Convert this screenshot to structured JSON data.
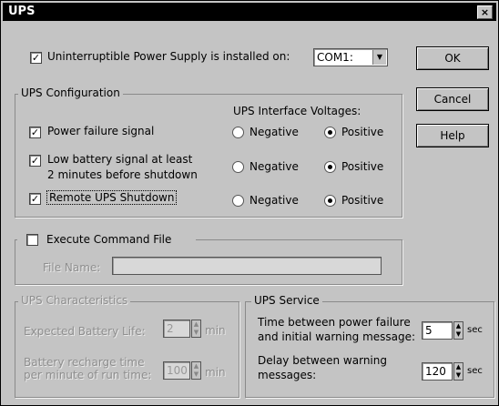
{
  "window": {
    "title": "UPS",
    "close_glyph": "×"
  },
  "ups_installed": {
    "checked": true,
    "label": "Uninterruptible Power Supply is installed on:",
    "port": "COM1:"
  },
  "buttons": {
    "ok": "OK",
    "cancel": "Cancel",
    "help": "Help"
  },
  "config": {
    "legend": "UPS Configuration",
    "voltages_heading": "UPS Interface Voltages:",
    "negative": "Negative",
    "positive": "Positive",
    "rows": [
      {
        "label": "Power failure signal",
        "label2": "",
        "checked": true,
        "polarity": "Positive"
      },
      {
        "label": "Low battery signal at least",
        "label2": "2 minutes before shutdown",
        "checked": true,
        "polarity": "Positive"
      },
      {
        "label": "Remote UPS Shutdown",
        "label2": "",
        "checked": true,
        "polarity": "Positive"
      }
    ]
  },
  "command": {
    "checked": false,
    "label": "Execute Command File",
    "file_label": "File Name:",
    "file_value": ""
  },
  "characteristics": {
    "legend": "UPS Characteristics",
    "battery_life_label": "Expected Battery Life:",
    "battery_life_value": "2",
    "battery_life_unit": "min",
    "recharge_label_1": "Battery recharge time",
    "recharge_label_2": "per minute of run time:",
    "recharge_value": "100",
    "recharge_unit": "min"
  },
  "service": {
    "legend": "UPS Service",
    "warn_label_1": "Time between power failure",
    "warn_label_2": "and initial warning message:",
    "warn_value": "5",
    "warn_unit": "sec",
    "delay_label_1": "Delay between warning",
    "delay_label_2": "messages:",
    "delay_value": "120",
    "delay_unit": "sec"
  }
}
